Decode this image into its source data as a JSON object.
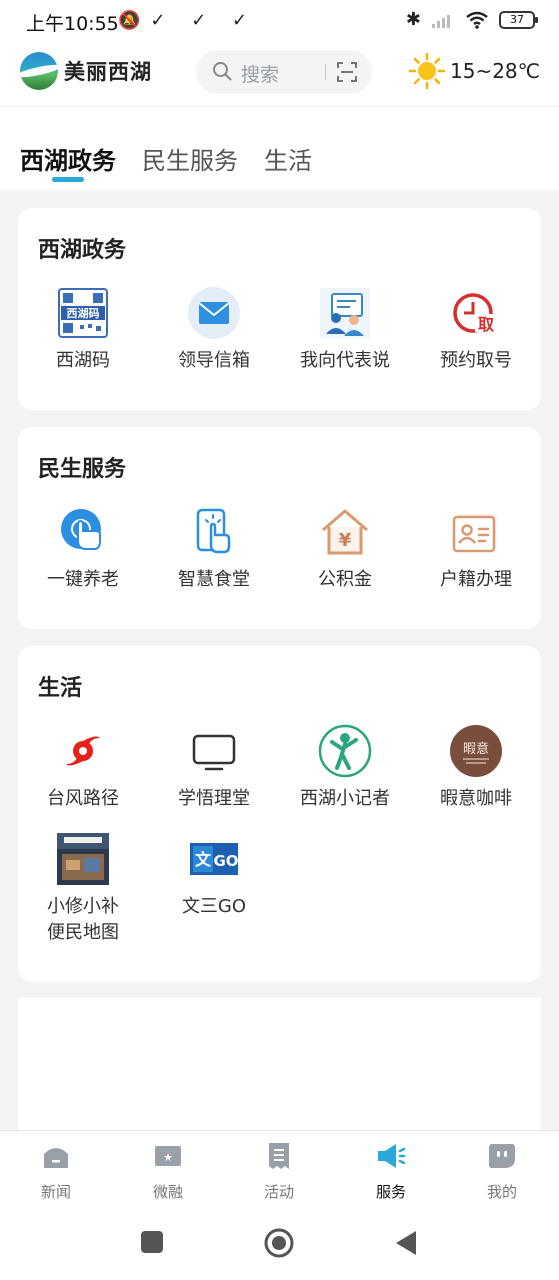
{
  "status_bar": {
    "time": "上午10:55",
    "left_icons": "✓ ✓ ✓",
    "battery": "37"
  },
  "header": {
    "app_name": "美丽西湖",
    "search_placeholder": "搜索",
    "weather": "15~28℃"
  },
  "tabs": [
    {
      "label": "西湖政务",
      "active": true
    },
    {
      "label": "民生服务",
      "active": false
    },
    {
      "label": "生活",
      "active": false
    }
  ],
  "sections": {
    "gov": {
      "title": "西湖政务",
      "items": [
        {
          "label": "西湖码",
          "icon": "qr-code-icon"
        },
        {
          "label": "领导信箱",
          "icon": "mail-icon"
        },
        {
          "label": "我向代表说",
          "icon": "representative-icon"
        },
        {
          "label": "预约取号",
          "icon": "clock-ticket-icon"
        }
      ]
    },
    "livelihood": {
      "title": "民生服务",
      "items": [
        {
          "label": "一键养老",
          "icon": "tap-hand-icon"
        },
        {
          "label": "智慧食堂",
          "icon": "touch-screen-icon"
        },
        {
          "label": "公积金",
          "icon": "yuan-house-icon"
        },
        {
          "label": "户籍办理",
          "icon": "id-card-icon"
        }
      ]
    },
    "life": {
      "title": "生活",
      "items": [
        {
          "label": "台风路径",
          "icon": "typhoon-icon"
        },
        {
          "label": "学悟理堂",
          "icon": "tv-icon"
        },
        {
          "label": "西湖小记者",
          "icon": "reporter-icon"
        },
        {
          "label": "暇意咖啡",
          "icon": "coffee-icon"
        },
        {
          "label": "小修小补",
          "label2": "便民地图",
          "icon": "repair-map-icon"
        },
        {
          "label": "文三GO",
          "icon": "wensan-go-icon"
        }
      ]
    }
  },
  "bottom_nav": [
    {
      "label": "新闻",
      "icon": "home-icon",
      "active": false
    },
    {
      "label": "微融",
      "icon": "star-tv-icon",
      "active": false
    },
    {
      "label": "活动",
      "icon": "receipt-icon",
      "active": false
    },
    {
      "label": "服务",
      "icon": "megaphone-icon",
      "active": true
    },
    {
      "label": "我的",
      "icon": "chat-face-icon",
      "active": false
    }
  ],
  "colors": {
    "accent": "#2aa8d8",
    "background": "#f3f4f6"
  }
}
